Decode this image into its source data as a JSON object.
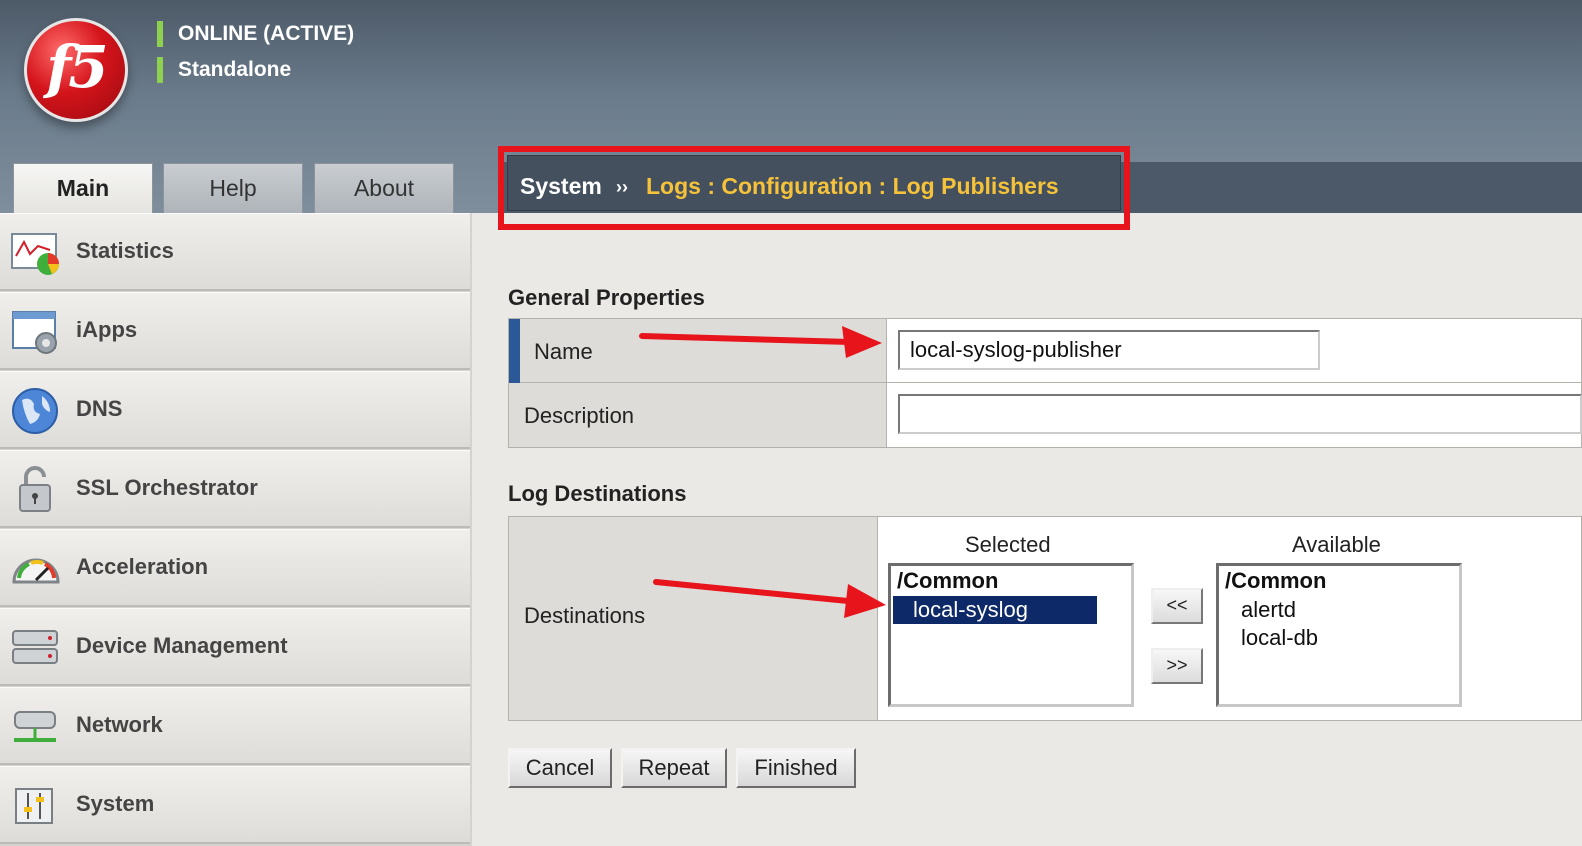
{
  "header": {
    "logo_text": "f5",
    "status_primary": "ONLINE (ACTIVE)",
    "status_secondary": "Standalone",
    "status_color": "#8fd14f"
  },
  "tabs": [
    {
      "label": "Main",
      "active": true
    },
    {
      "label": "Help",
      "active": false
    },
    {
      "label": "About",
      "active": false
    }
  ],
  "breadcrumb": {
    "root": "System",
    "separator": "››",
    "path": "Logs : Configuration : Log Publishers",
    "path_color": "#f6c23a",
    "highlight_color": "#e8141c"
  },
  "sidebar": {
    "items": [
      {
        "label": "Statistics",
        "icon": "statistics-icon"
      },
      {
        "label": "iApps",
        "icon": "iapps-icon"
      },
      {
        "label": "DNS",
        "icon": "globe-icon"
      },
      {
        "label": "SSL Orchestrator",
        "icon": "lock-icon"
      },
      {
        "label": "Acceleration",
        "icon": "gauge-icon"
      },
      {
        "label": "Device Management",
        "icon": "server-icon"
      },
      {
        "label": "Network",
        "icon": "network-icon"
      },
      {
        "label": "System",
        "icon": "system-icon"
      }
    ]
  },
  "general": {
    "title": "General Properties",
    "name_label": "Name",
    "name_value": "local-syslog-publisher",
    "description_label": "Description",
    "description_value": ""
  },
  "log_destinations": {
    "title": "Log Destinations",
    "destinations_label": "Destinations",
    "selected_heading": "Selected",
    "available_heading": "Available",
    "selected": {
      "group": "/Common",
      "options": [
        "local-syslog"
      ],
      "highlighted": "local-syslog"
    },
    "available": {
      "group": "/Common",
      "options": [
        "alertd",
        "local-db"
      ]
    },
    "move_left_label": "<<",
    "move_right_label": ">>"
  },
  "actions": {
    "cancel": "Cancel",
    "repeat": "Repeat",
    "finished": "Finished"
  }
}
